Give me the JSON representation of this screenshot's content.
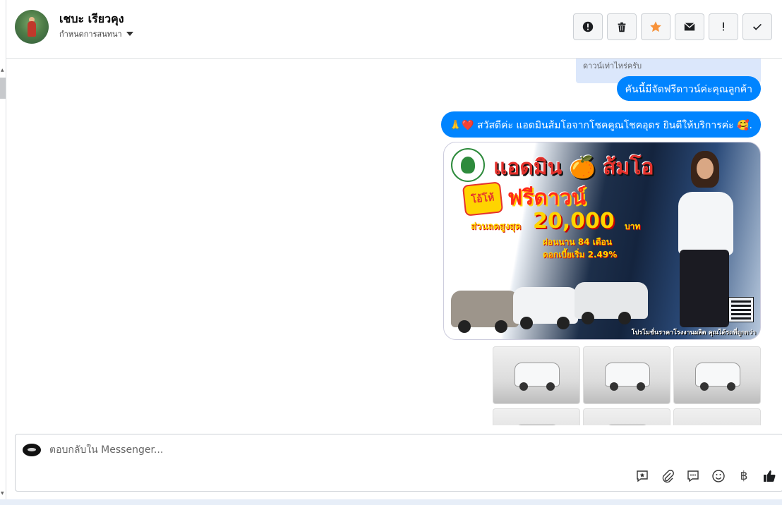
{
  "header": {
    "user_name": "เชบะ เรียวคุง",
    "convo_settings_label": "กำหนดการสนทนา",
    "actions": [
      {
        "name": "important-button",
        "icon": "alert-circle-icon"
      },
      {
        "name": "delete-button",
        "icon": "trash-icon"
      },
      {
        "name": "star-button",
        "icon": "star-icon",
        "color": "#f7923a"
      },
      {
        "name": "mark-unread-button",
        "icon": "envelope-icon"
      },
      {
        "name": "spam-button",
        "icon": "exclamation-icon"
      },
      {
        "name": "done-button",
        "icon": "check-icon"
      }
    ]
  },
  "thread": {
    "quoted_text": "ดาวน์เท่าไหร่ครับ",
    "messages": [
      {
        "text": "คันนี้มีจัดฟรีดาวน์ค่ะคุณลูกค้า"
      },
      {
        "prefix_emoji": "🙏❤️",
        "text": "สวัสดีค่ะ แอดมินส้มโอจากโชคคูณโชคอุดร ยินดีให้บริการค่ะ",
        "suffix_emoji": "🥰."
      }
    ],
    "promo_image": {
      "title": "แอดมิน 🍊 ส้มโอ",
      "burst": "โอ้โห้",
      "headline": "ฟรีดาวน์",
      "discount_label": "ส่วนลดสูงสุด",
      "discount_amount": "20,000",
      "currency": "บาท",
      "term": "ผ่อนนาน 84 เดือน",
      "rate": "ดอกเบี้ยเริ่ม 2.49%",
      "footer": "โปรโมชั่นราคาโรงงานผลิต คุณได้รถที่ถูกกว่า"
    },
    "photo_count": 6
  },
  "composer": {
    "placeholder": "ตอบกลับใน Messenger...",
    "tools": [
      "saved-reply-icon",
      "attach-icon",
      "chat-bubble-icon",
      "emoji-icon",
      "baht-icon",
      "thumbs-up-icon"
    ],
    "baht_symbol": "฿"
  },
  "colors": {
    "bubble": "#0084ff",
    "quoted_bg": "#dbe7fb",
    "star": "#f7923a"
  }
}
